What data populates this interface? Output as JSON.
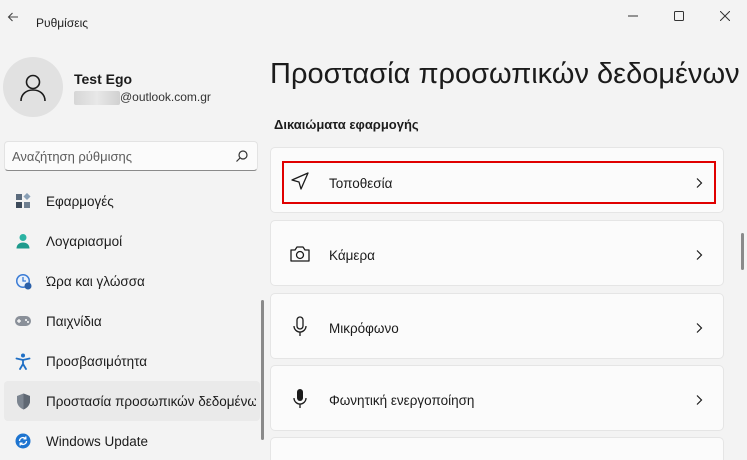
{
  "app": {
    "title": "Ρυθμίσεις"
  },
  "window_controls": {
    "minimize": "—",
    "maximize": "☐",
    "close": "✕"
  },
  "profile": {
    "name": "Test Ego",
    "email_suffix": "@outlook.com.gr"
  },
  "search": {
    "placeholder": "Αναζήτηση ρύθμισης"
  },
  "sidebar": {
    "items": [
      {
        "label": "Εφαρμογές",
        "icon": "apps-icon"
      },
      {
        "label": "Λογαριασμοί",
        "icon": "accounts-icon"
      },
      {
        "label": "Ώρα και γλώσσα",
        "icon": "time-language-icon"
      },
      {
        "label": "Παιχνίδια",
        "icon": "gaming-icon"
      },
      {
        "label": "Προσβασιμότητα",
        "icon": "accessibility-icon"
      },
      {
        "label": "Προστασία προσωπικών δεδομένων και ασφάλεια",
        "icon": "shield-icon",
        "selected": true
      },
      {
        "label": "Windows Update",
        "icon": "windows-update-icon"
      }
    ]
  },
  "main": {
    "title": "Προστασία προσωπικών δεδομένων",
    "section": "Δικαιώματα εφαρμογής",
    "cards": [
      {
        "label": "Τοποθεσία",
        "icon": "location-icon"
      },
      {
        "label": "Κάμερα",
        "icon": "camera-icon"
      },
      {
        "label": "Μικρόφωνο",
        "icon": "microphone-icon"
      },
      {
        "label": "Φωνητική ενεργοποίηση",
        "icon": "voice-activation-icon"
      }
    ]
  },
  "colors": {
    "accent": "#0067c0",
    "highlight": "#e00000",
    "background": "#f3f3f3"
  }
}
